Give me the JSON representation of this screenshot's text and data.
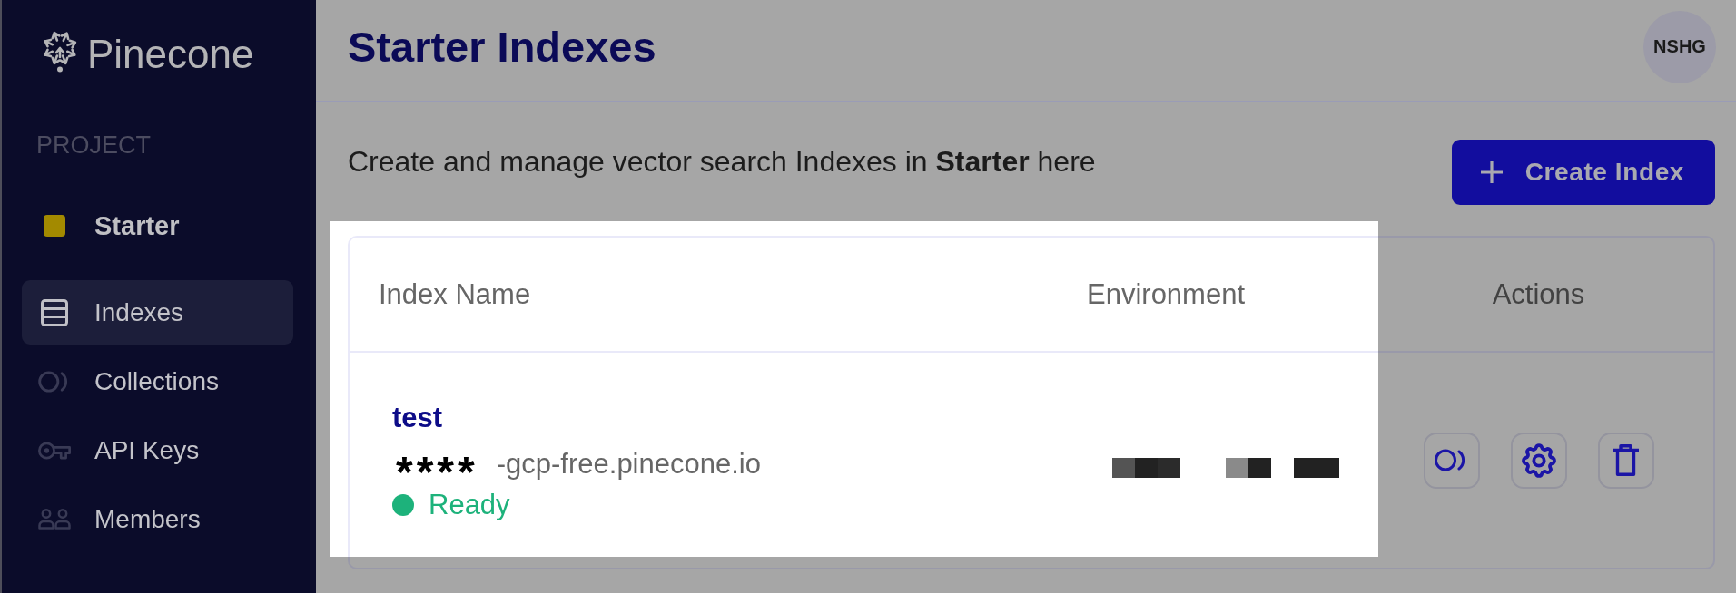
{
  "sidebar": {
    "logo": "Pinecone",
    "section_label": "PROJECT",
    "project": "Starter",
    "items": [
      {
        "label": "Indexes",
        "selected": true
      },
      {
        "label": "Collections",
        "selected": false
      },
      {
        "label": "API Keys",
        "selected": false
      },
      {
        "label": "Members",
        "selected": false
      }
    ]
  },
  "header": {
    "title": "Starter Indexes",
    "avatar": "NSHG"
  },
  "intro": {
    "text": "Create and manage vector search Indexes in **Starter** here",
    "button": "Create Index"
  },
  "table": {
    "columns": [
      {
        "label": "Index Name",
        "highlighted": true
      },
      {
        "label": "Environment",
        "highlighted": true
      },
      {
        "label": "Actions",
        "highlighted": false
      }
    ],
    "rows": [
      {
        "name": "test",
        "host_mask": "****",
        "host": "-gcp-free.pinecone.io",
        "status": {
          "label": "Ready",
          "color": "#1db27b"
        }
      }
    ]
  }
}
